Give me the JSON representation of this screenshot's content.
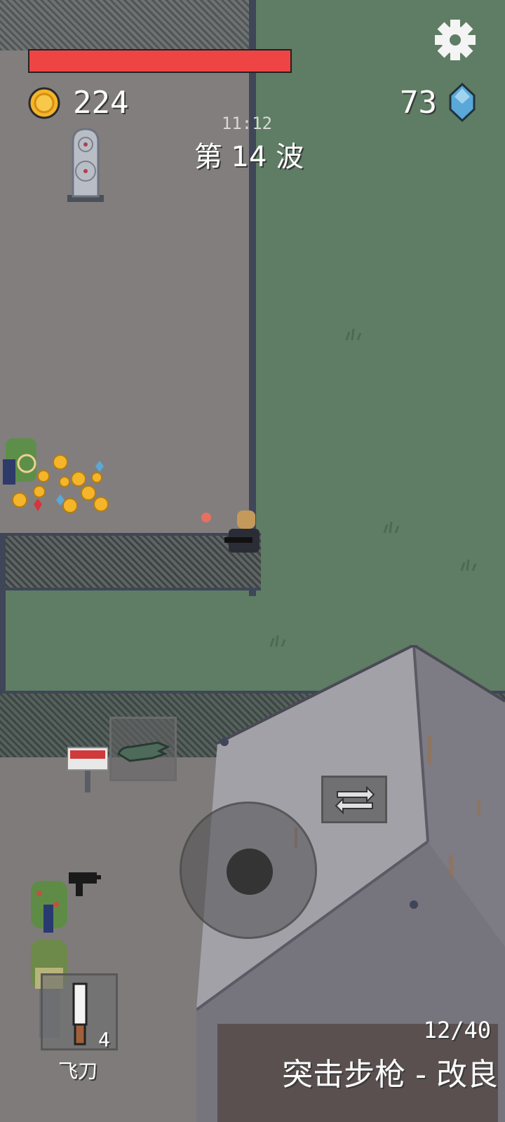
{
  "hud": {
    "health_fraction": 1.0,
    "coins": "224",
    "gems": "73",
    "timer": "11:12",
    "wave_label": "第 14 波"
  },
  "weapon": {
    "ammo": "12/40",
    "name": "突击步枪 - 改良"
  },
  "slot": {
    "label": "飞刀",
    "count": "4"
  },
  "colors": {
    "health": "#ef4444",
    "grass": "#5e7d64",
    "ground": "#827e7e",
    "coin": "#f5b52a",
    "gem": "#5aa8d8"
  },
  "icons": [
    "settings-gear-icon",
    "coin-icon",
    "gem-icon",
    "swap-weapon-icon",
    "hand-pointer-icon",
    "knife-icon"
  ]
}
